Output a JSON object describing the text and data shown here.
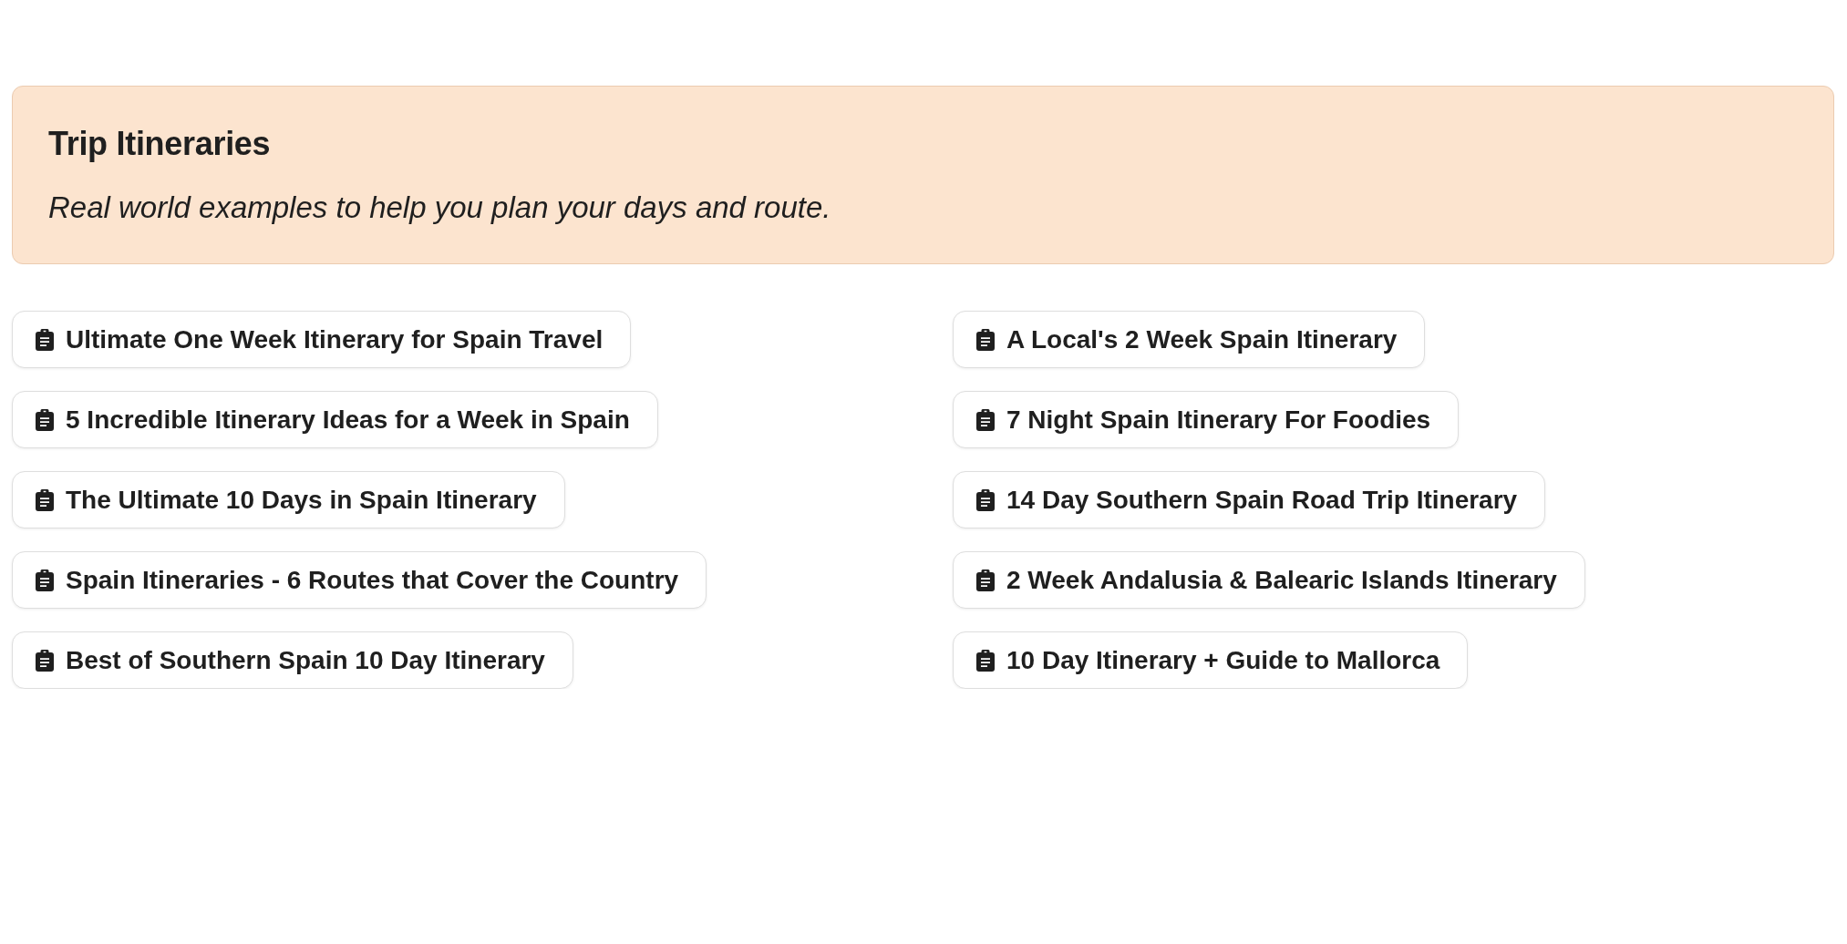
{
  "banner": {
    "title": "Trip Itineraries",
    "subtitle": "Real world examples to help you plan your days and route."
  },
  "columns": [
    {
      "links": [
        {
          "label": "Ultimate One Week Itinerary for Spain Travel"
        },
        {
          "label": "5 Incredible Itinerary Ideas for a Week in Spain"
        },
        {
          "label": "The Ultimate 10 Days in Spain Itinerary"
        },
        {
          "label": "Spain Itineraries - 6 Routes that Cover the Country"
        },
        {
          "label": "Best of Southern Spain 10 Day Itinerary"
        }
      ]
    },
    {
      "links": [
        {
          "label": "A Local's 2 Week Spain Itinerary"
        },
        {
          "label": "7 Night Spain Itinerary For Foodies"
        },
        {
          "label": "14 Day Southern Spain Road Trip Itinerary"
        },
        {
          "label": "2 Week Andalusia & Balearic Islands Itinerary"
        },
        {
          "label": "10 Day Itinerary + Guide to Mallorca"
        }
      ]
    }
  ]
}
